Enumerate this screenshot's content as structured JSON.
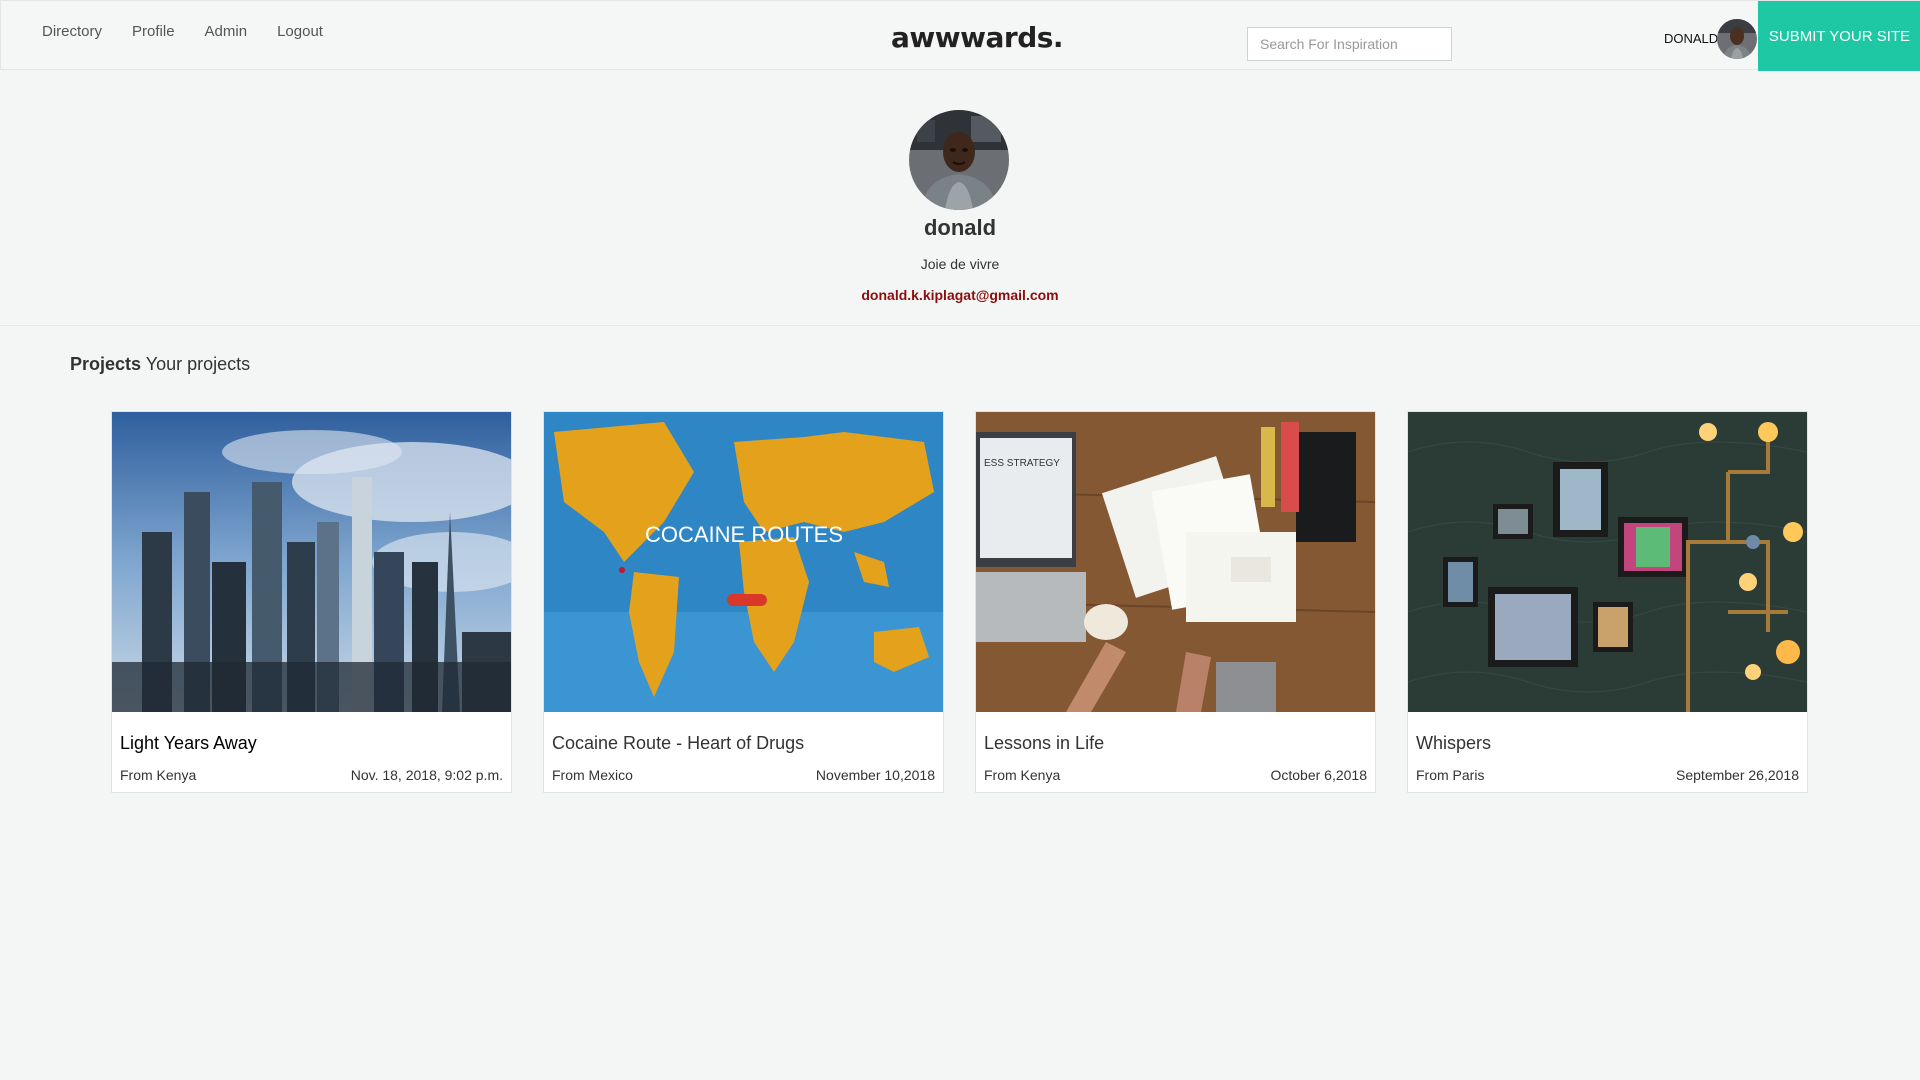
{
  "nav": {
    "links": [
      "Directory",
      "Profile",
      "Admin",
      "Logout"
    ],
    "logo": "awwwards.",
    "search_placeholder": "Search For Inspiration",
    "username": "DONALD",
    "submit_label": "SUBMIT YOUR SITE"
  },
  "profile": {
    "name": "donald",
    "bio": "Joie de vivre",
    "email": "donald.k.kiplagat@gmail.com"
  },
  "projects_section": {
    "title_bold": "Projects",
    "title_rest": "Your projects"
  },
  "projects": [
    {
      "title": "Light Years Away",
      "location": "From Kenya",
      "date": "Nov. 18, 2018, 9:02 p.m."
    },
    {
      "title": "Cocaine Route - Heart of Drugs",
      "location": "From Mexico",
      "date": "November 10,2018",
      "image_text": "COCAINE ROUTES"
    },
    {
      "title": "Lessons in Life",
      "location": "From Kenya",
      "date": "October 6,2018",
      "image_text": "ESS STRATEGY"
    },
    {
      "title": "Whispers",
      "location": "From Paris",
      "date": "September 26,2018"
    }
  ],
  "colors": {
    "accent": "#1ec8a5",
    "email": "#8b0d0d",
    "background": "#f3f6f5"
  }
}
